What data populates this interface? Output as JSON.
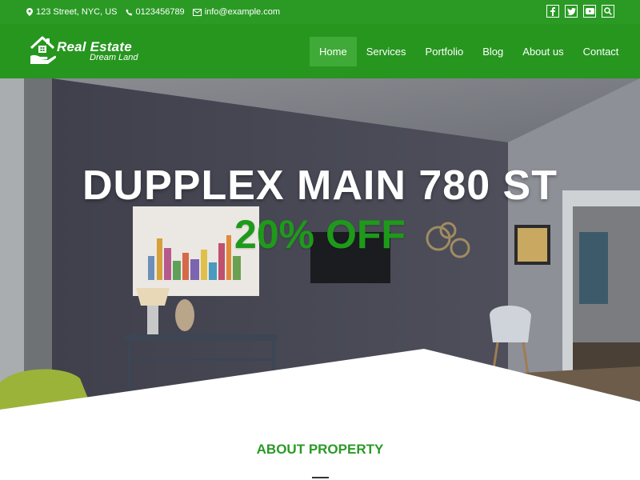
{
  "colors": {
    "brand_green": "#2a9a25",
    "nav_active": "#3faa37",
    "offer_green": "#1e9a1a"
  },
  "topbar": {
    "address": "123 Street, NYC, US",
    "phone": "0123456789",
    "email": "info@example.com",
    "address_icon": "map-marker-icon",
    "phone_icon": "phone-icon",
    "email_icon": "envelope-icon",
    "socials": [
      "facebook-icon",
      "twitter-icon",
      "youtube-icon",
      "search-icon"
    ]
  },
  "logo": {
    "title": "Real Estate",
    "subtitle": "Dream Land",
    "icon": "house-hand-icon"
  },
  "nav": {
    "items": [
      {
        "label": "Home",
        "active": true
      },
      {
        "label": "Services",
        "active": false
      },
      {
        "label": "Portfolio",
        "active": false
      },
      {
        "label": "Blog",
        "active": false
      },
      {
        "label": "About us",
        "active": false
      },
      {
        "label": "Contact",
        "active": false
      }
    ]
  },
  "hero": {
    "title": "DUPPLEX MAIN 780 ST",
    "offer": "20% OFF"
  },
  "about": {
    "title": "ABOUT PROPERTY"
  }
}
